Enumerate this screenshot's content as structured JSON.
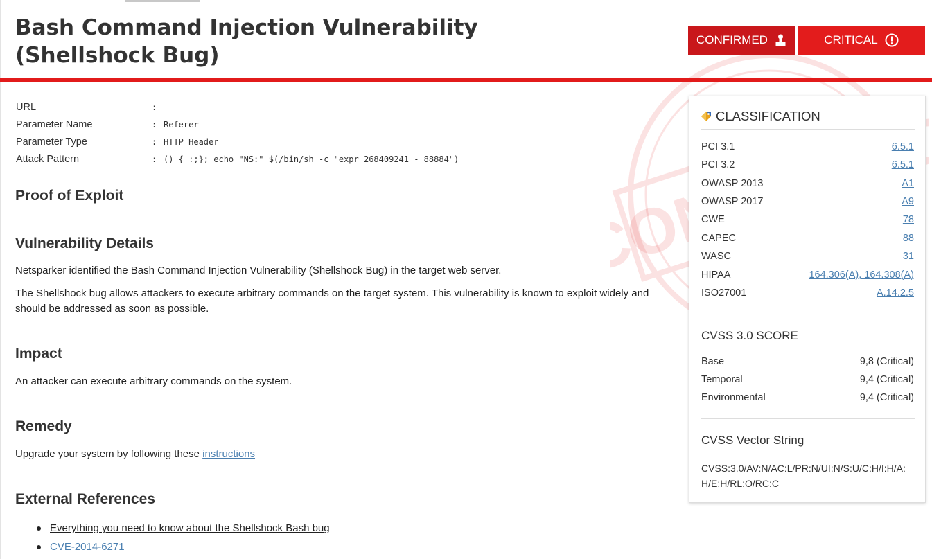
{
  "header": {
    "title": "Bash Command Injection Vulnerability (Shellshock Bug)",
    "badges": {
      "confirmed": "CONFIRMED",
      "critical": "CRITICAL"
    },
    "stamp_text": "CONFIRMED"
  },
  "details": [
    {
      "label": "URL",
      "value": ""
    },
    {
      "label": "Parameter Name",
      "value": "Referer"
    },
    {
      "label": "Parameter Type",
      "value": "HTTP Header"
    },
    {
      "label": "Attack Pattern",
      "value": "() { :;}; echo \"NS:\" $(/bin/sh -c \"expr 268409241 - 88884\")"
    }
  ],
  "sections": {
    "proof": {
      "title": "Proof of Exploit"
    },
    "vulnerability": {
      "title": "Vulnerability Details",
      "p1": "Netsparker identified the Bash Command Injection Vulnerability (Shellshock Bug) in the target web server.",
      "p2": "The Shellshock bug allows attackers to execute arbitrary commands on the target system. This vulnerability is known to exploit widely and should be addressed as soon as possible."
    },
    "impact": {
      "title": "Impact",
      "text": "An attacker can execute arbitrary commands on the system."
    },
    "remedy": {
      "title": "Remedy",
      "text": "Upgrade your system by following these ",
      "link": "instructions"
    },
    "references": {
      "title": "External References",
      "items": [
        "Everything you need to know about the Shellshock Bash bug",
        "CVE-2014-6271"
      ]
    }
  },
  "classification": {
    "title": "CLASSIFICATION",
    "rows": [
      {
        "key": "PCI 3.1",
        "value": "6.5.1"
      },
      {
        "key": "PCI 3.2",
        "value": "6.5.1"
      },
      {
        "key": "OWASP 2013",
        "value": "A1"
      },
      {
        "key": "OWASP 2017",
        "value": "A9"
      },
      {
        "key": "CWE",
        "value": "78"
      },
      {
        "key": "CAPEC",
        "value": "88"
      },
      {
        "key": "WASC",
        "value": "31"
      },
      {
        "key": "HIPAA",
        "value": "164.306(A), 164.308(A)"
      },
      {
        "key": "ISO27001",
        "value": "A.14.2.5"
      }
    ],
    "cvss": {
      "title": "CVSS 3.0 SCORE",
      "rows": [
        {
          "key": "Base",
          "value": "9,8 (Critical)"
        },
        {
          "key": "Temporal",
          "value": "9,4 (Critical)"
        },
        {
          "key": "Environmental",
          "value": "9,4 (Critical)"
        }
      ]
    },
    "vector": {
      "title": "CVSS Vector String",
      "value": "CVSS:3.0/AV:N/AC:L/PR:N/UI:N/S:U/C:H/I:H/A:H/E:H/RL:O/RC:C"
    }
  },
  "colors": {
    "accent_red": "#e21b1b",
    "confirmed_bg": "#c9171b",
    "link": "#4a7fb0"
  }
}
